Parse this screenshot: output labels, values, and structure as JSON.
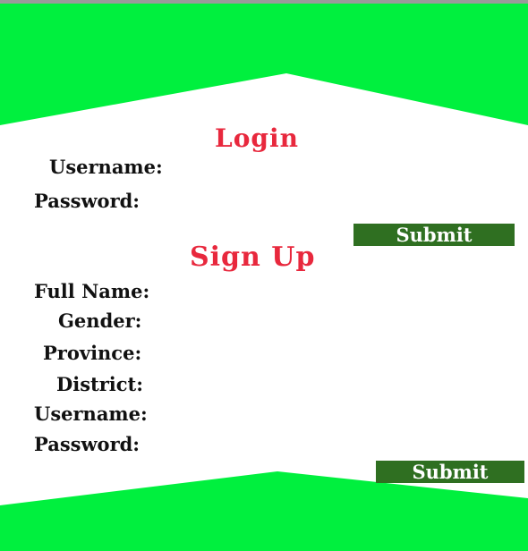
{
  "colors": {
    "band_green": "#00f03e",
    "title_red": "#e8283d",
    "button_green": "#2f6f21"
  },
  "login": {
    "title": "Login",
    "username_label": "Username:",
    "password_label": "Password:",
    "submit_label": "Submit"
  },
  "signup": {
    "title": "Sign Up",
    "full_name_label": "Full Name:",
    "gender_label": "Gender:",
    "province_label": "Province:",
    "district_label": "District:",
    "username_label": "Username:",
    "password_label": "Password:",
    "submit_label": "Submit"
  }
}
